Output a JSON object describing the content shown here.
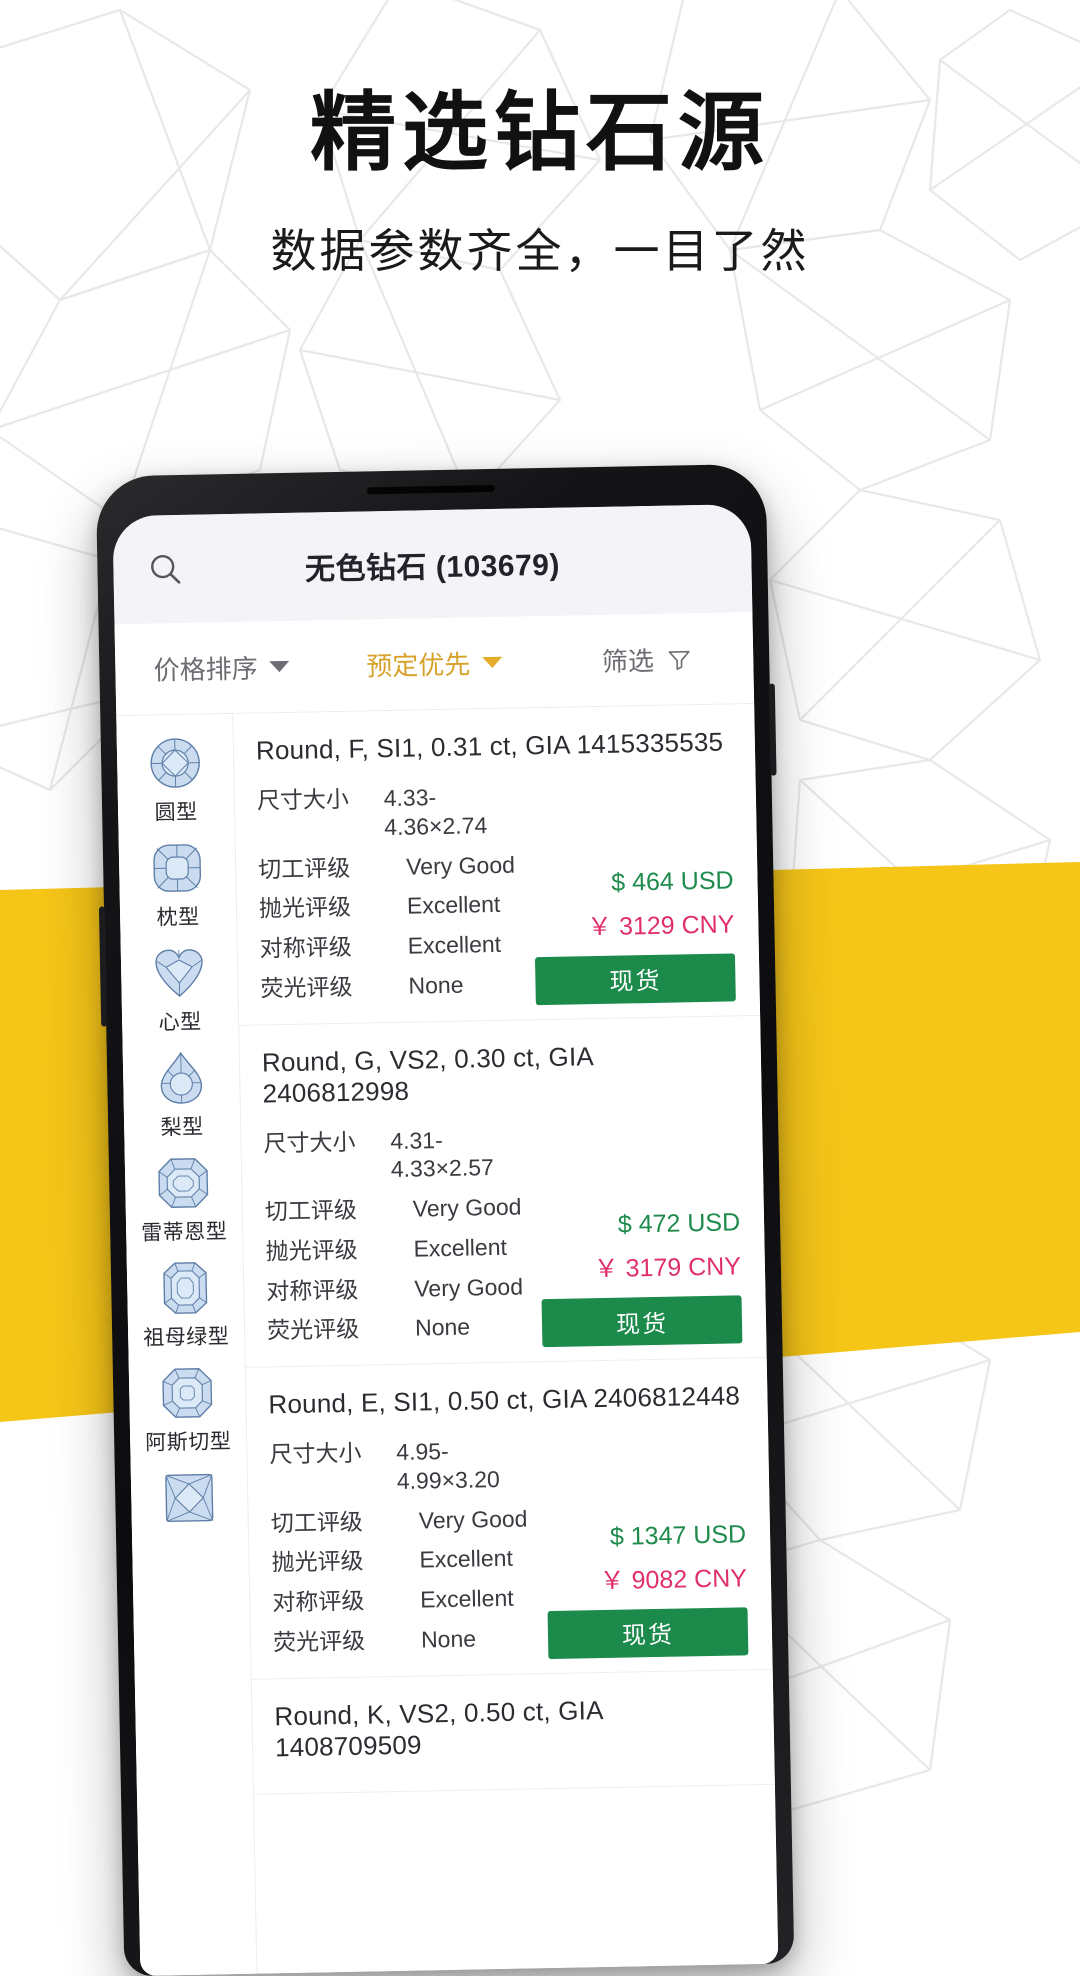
{
  "hero": {
    "title": "精选钻石源",
    "subtitle": "数据参数齐全，一目了然"
  },
  "colors": {
    "accent_yellow": "#F5C518",
    "gold_text": "#D8A12A",
    "green_price": "#1E8A4C",
    "pink_price": "#E0306A",
    "green_button": "#1B8A4B",
    "header_bg": "#F3F3F8"
  },
  "app": {
    "header": {
      "search_icon": "search-icon",
      "title": "无色钻石 (103679)"
    },
    "sort_bar": {
      "price_sort": "价格排序",
      "reserve_first": "预定优先",
      "filter": "筛选",
      "filter_icon": "funnel-icon"
    },
    "shapes": [
      {
        "label": "圆型",
        "icon": "round-diamond-icon"
      },
      {
        "label": "枕型",
        "icon": "cushion-diamond-icon"
      },
      {
        "label": "心型",
        "icon": "heart-diamond-icon"
      },
      {
        "label": "梨型",
        "icon": "pear-diamond-icon"
      },
      {
        "label": "雷蒂恩型",
        "icon": "radiant-diamond-icon"
      },
      {
        "label": "祖母绿型",
        "icon": "emerald-diamond-icon"
      },
      {
        "label": "阿斯切型",
        "icon": "asscher-diamond-icon"
      },
      {
        "label": "",
        "icon": "princess-diamond-icon"
      }
    ],
    "spec_labels": {
      "size": "尺寸大小",
      "cut": "切工评级",
      "polish": "抛光评级",
      "symmetry": "对称评级",
      "fluorescence": "荧光评级"
    },
    "stock_label": "现货",
    "diamonds": [
      {
        "title": "Round, F, SI1, 0.31 ct, GIA 1415335535",
        "size": "4.33-4.36×2.74",
        "cut": "Very Good",
        "polish": "Excellent",
        "symmetry": "Excellent",
        "fluorescence": "None",
        "price_usd": "$ 464 USD",
        "price_cny": "￥ 3129 CNY"
      },
      {
        "title": "Round, G, VS2, 0.30 ct, GIA 2406812998",
        "size": "4.31-4.33×2.57",
        "cut": "Very Good",
        "polish": "Excellent",
        "symmetry": "Very Good",
        "fluorescence": "None",
        "price_usd": "$ 472 USD",
        "price_cny": "￥ 3179 CNY"
      },
      {
        "title": "Round, E, SI1, 0.50 ct, GIA 2406812448",
        "size": "4.95-4.99×3.20",
        "cut": "Very Good",
        "polish": "Excellent",
        "symmetry": "Excellent",
        "fluorescence": "None",
        "price_usd": "$ 1347 USD",
        "price_cny": "￥ 9082 CNY"
      },
      {
        "title": "Round, K, VS2, 0.50 ct, GIA 1408709509",
        "size": "",
        "cut": "",
        "polish": "",
        "symmetry": "",
        "fluorescence": "",
        "price_usd": "",
        "price_cny": ""
      }
    ]
  }
}
